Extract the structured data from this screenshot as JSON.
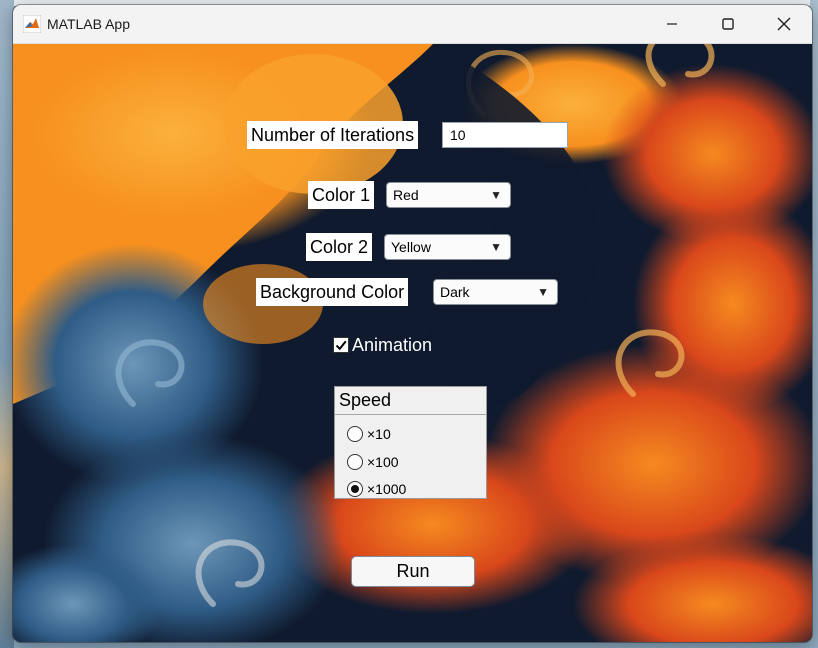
{
  "window": {
    "title": "MATLAB App"
  },
  "form": {
    "iterations_label": "Number of Iterations",
    "iterations_value": "10",
    "color1_label": "Color 1",
    "color1_value": "Red",
    "color2_label": "Color 2",
    "color2_value": "Yellow",
    "background_label": "Background Color",
    "background_value": "Dark",
    "animation_label": "Animation",
    "animation_checked": true
  },
  "speed": {
    "title": "Speed",
    "options": [
      {
        "label": "×10",
        "selected": false
      },
      {
        "label": "×100",
        "selected": false
      },
      {
        "label": "×1000",
        "selected": true
      }
    ]
  },
  "run_label": "Run",
  "colors": {
    "fractal_dark": "#0f1a2e",
    "fractal_orange": "#f7901e",
    "fractal_red": "#e0501c",
    "fractal_blue": "#3a6a96"
  }
}
